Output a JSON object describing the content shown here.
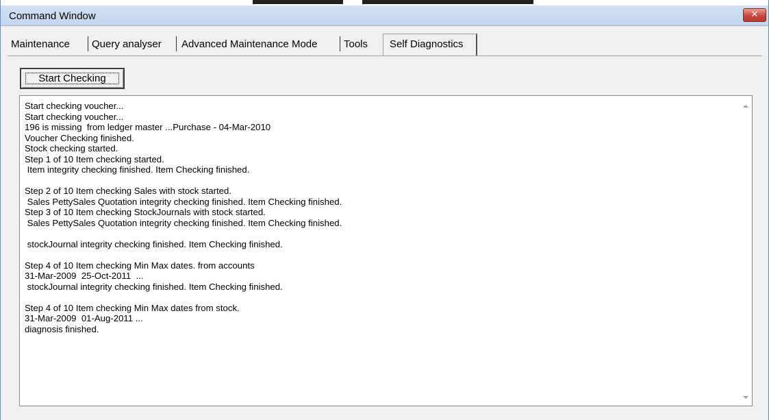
{
  "window": {
    "title": "Command Window",
    "close_symbol": "✕"
  },
  "tabs": [
    {
      "label": "Maintenance",
      "active": false
    },
    {
      "label": "Query analyser",
      "active": false
    },
    {
      "label": "Advanced Maintenance Mode",
      "active": false
    },
    {
      "label": "Tools",
      "active": false
    },
    {
      "label": "Self Diagnostics",
      "active": true
    }
  ],
  "actions": {
    "start_checking_label": "Start Checking"
  },
  "log": {
    "lines": [
      "Start checking voucher...",
      "Start checking voucher...",
      "196 is missing  from ledger master ...Purchase - 04-Mar-2010",
      "Voucher Checking finished.",
      "Stock checking started.",
      "Step 1 of 10 Item checking started.",
      " Item integrity checking finished. Item Checking finished.",
      "",
      "Step 2 of 10 Item checking Sales with stock started.",
      " Sales PettySales Quotation integrity checking finished. Item Checking finished.",
      "Step 3 of 10 Item checking StockJournals with stock started.",
      " Sales PettySales Quotation integrity checking finished. Item Checking finished.",
      "",
      " stockJournal integrity checking finished. Item Checking finished.",
      "",
      "Step 4 of 10 Item checking Min Max dates. from accounts",
      "31-Mar-2009  25-Oct-2011  ...",
      " stockJournal integrity checking finished. Item Checking finished.",
      "",
      "Step 4 of 10 Item checking Min Max dates from stock.",
      "31-Mar-2009  01-Aug-2011 ...",
      "diagnosis finished."
    ]
  },
  "icons": {
    "close": "close-icon",
    "scroll_up": "scroll-up-arrow-icon",
    "scroll_down": "scroll-down-arrow-icon"
  },
  "colors": {
    "titlebar": "#c2d6ee",
    "close_button": "#c9473a",
    "window_bg": "#f0f0f0"
  }
}
